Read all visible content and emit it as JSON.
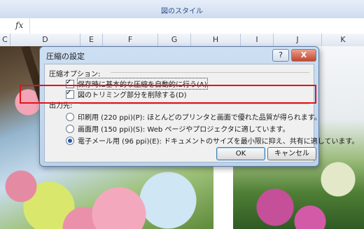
{
  "ribbon": {
    "title": "図のスタイル"
  },
  "formula_bar": {
    "fx": "fx"
  },
  "columns": [
    "C",
    "D",
    "E",
    "F",
    "G",
    "H",
    "I",
    "J",
    "K"
  ],
  "dialog": {
    "title": "圧縮の設定",
    "help_label": "?",
    "close_label": "X",
    "options_group": {
      "label": "圧縮オプション:",
      "items": [
        {
          "label": "保存時に基本的な圧縮を自動的に行う(A)",
          "checked": true
        },
        {
          "label": "図のトリミング部分を削除する(D)",
          "checked": true
        }
      ]
    },
    "output_group": {
      "label": "出力先:",
      "items": [
        {
          "label": "印刷用 (220 ppi)(P): ほとんどのプリンタと画面で優れた品質が得られます。",
          "selected": false
        },
        {
          "label": "画面用 (150 ppi)(S): Web ページやプロジェクタに適しています。",
          "selected": false
        },
        {
          "label": "電子メール用 (96 ppi)(E): ドキュメントのサイズを最小限に抑え、共有に適しています。",
          "selected": true
        }
      ]
    },
    "ok_label": "OK",
    "cancel_label": "キャンセル"
  }
}
